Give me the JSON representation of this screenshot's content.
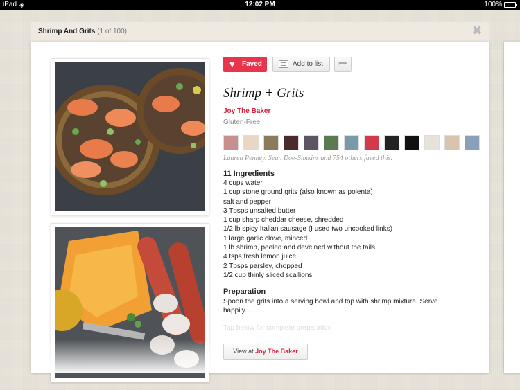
{
  "status_bar": {
    "device": "iPad",
    "time": "12:02 PM",
    "battery": "100%"
  },
  "header": {
    "title": "Shrimp And Grits",
    "count": "(1 of 100)"
  },
  "actions": {
    "faved_label": "Faved",
    "add_to_list_label": "Add to list"
  },
  "recipe": {
    "title": "Shrimp + Grits",
    "source": "Joy The Baker",
    "diet": "Gluten-Free",
    "faved_by": "Lauren Penney, Sean Doe-Simkins and 754 others faved this.",
    "ingredients_heading": "11 Ingredients",
    "ingredients": [
      "4 cups water",
      "1 cup stone ground grits (also known as polenta)",
      "salt and pepper",
      "3 Tbsps unsalted butter",
      "1 cup sharp cheddar cheese, shredded",
      "1/2 lb spicy Italian sausage (I used two uncooked links)",
      "1 large garlic clove, minced",
      "1 lb shrimp, peeled and deveined without the tails",
      "4 tsps fresh lemon juice",
      "2 Tbsps parsley, chopped",
      "1/2 cup thinly sliced scallions"
    ],
    "preparation_heading": "Preparation",
    "preparation_text": "Spoon the grits into a serving bowl and top with shrimp mixture.  Serve happily....",
    "tap_below": "Tap below for complete preparation",
    "view_prefix": "View at",
    "view_source": "Joy The Baker"
  },
  "avatars": [
    {
      "name": "avatar-1",
      "color": "#c98f8f"
    },
    {
      "name": "avatar-2",
      "color": "#e9d6c4"
    },
    {
      "name": "avatar-3",
      "color": "#8a7b5a"
    },
    {
      "name": "avatar-4",
      "color": "#4a2a2a"
    },
    {
      "name": "avatar-5",
      "color": "#5b5566"
    },
    {
      "name": "avatar-6",
      "color": "#5a7a52"
    },
    {
      "name": "avatar-7",
      "color": "#7a9aa8"
    },
    {
      "name": "avatar-8",
      "color": "#d23a4c"
    },
    {
      "name": "avatar-9",
      "color": "#222222"
    },
    {
      "name": "avatar-10",
      "color": "#111111"
    },
    {
      "name": "avatar-11",
      "color": "#e7e3dc"
    },
    {
      "name": "avatar-12",
      "color": "#d9c4b0"
    },
    {
      "name": "avatar-13",
      "color": "#8aa0b8"
    }
  ],
  "colors": {
    "accent": "#e8354c",
    "source_link": "#d6203b"
  }
}
